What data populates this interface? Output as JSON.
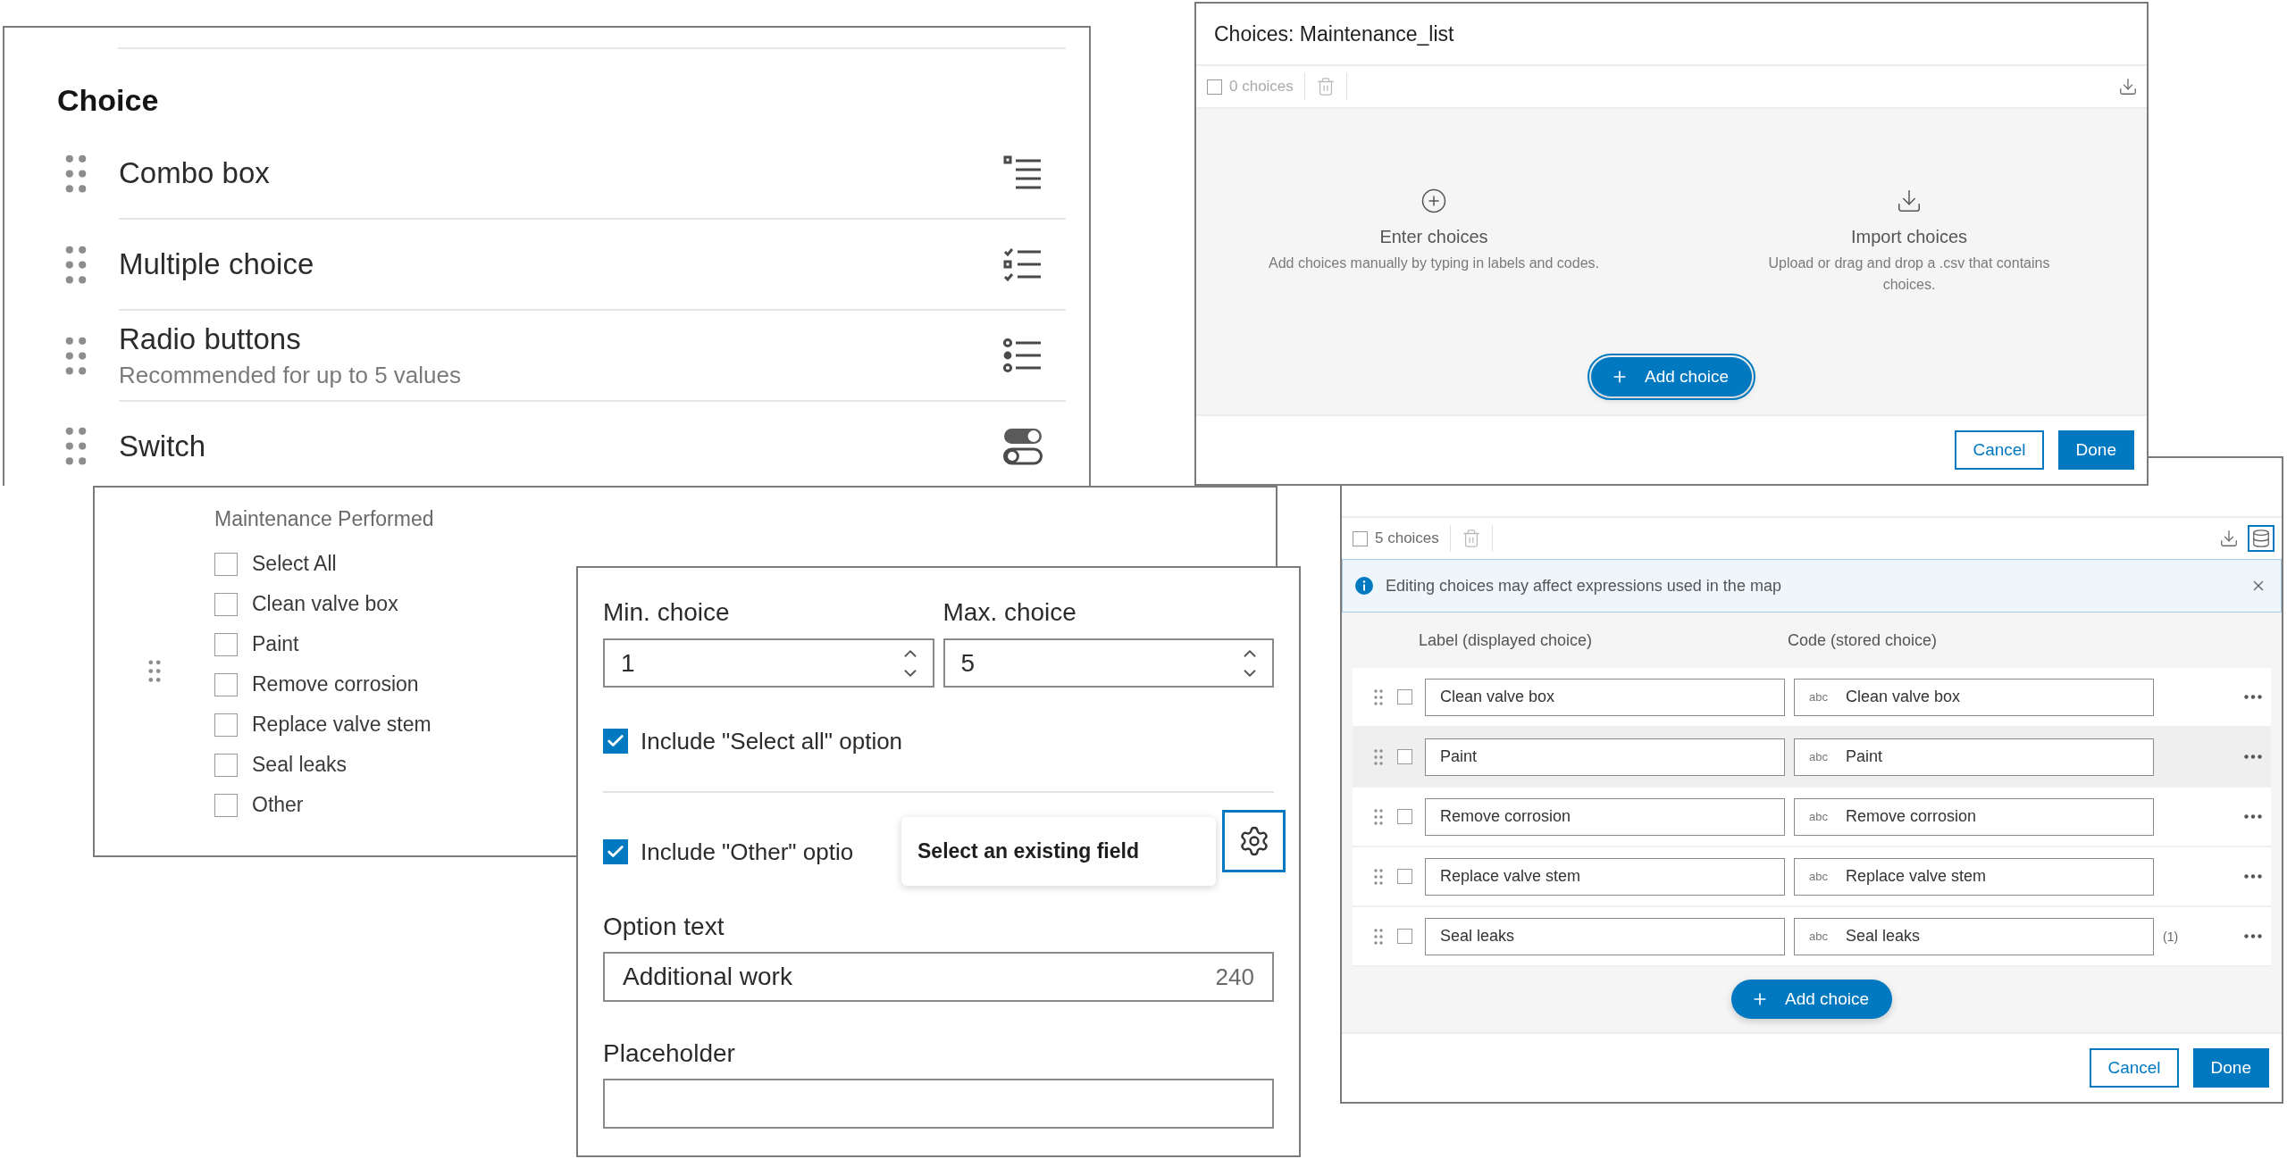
{
  "field_types": {
    "heading": "Choice",
    "items": [
      {
        "kind": "combo",
        "label": "Combo box"
      },
      {
        "kind": "multiple",
        "label": "Multiple choice"
      },
      {
        "kind": "radio",
        "label": "Radio buttons",
        "description": "Recommended for up to 5 values"
      },
      {
        "kind": "switch",
        "label": "Switch"
      }
    ]
  },
  "preview": {
    "title": "Maintenance Performed",
    "options": [
      {
        "label": "Select All",
        "checked": false
      },
      {
        "label": "Clean valve box",
        "checked": false
      },
      {
        "label": "Paint",
        "checked": false
      },
      {
        "label": "Remove corrosion",
        "checked": false
      },
      {
        "label": "Replace valve stem",
        "checked": false
      },
      {
        "label": "Seal leaks",
        "checked": false
      },
      {
        "label": "Other",
        "checked": false
      }
    ]
  },
  "settings": {
    "min": {
      "label": "Min. choice",
      "value": "1"
    },
    "max": {
      "label": "Max. choice",
      "value": "5"
    },
    "select_all": {
      "label": "Include \"Select all\" option",
      "checked": true
    },
    "other": {
      "label": "Include \"Other\" optio",
      "checked": true
    },
    "tooltip": "Select an existing field",
    "option_text": {
      "label": "Option text",
      "value": "Additional work",
      "counter": "240"
    },
    "placeholder": {
      "label": "Placeholder"
    }
  },
  "empty_dialog": {
    "title": "Choices: Maintenance_list",
    "all_checked": false,
    "count": "0 choices",
    "options": [
      {
        "kind": "enter",
        "title": "Enter choices",
        "description": "Add choices manually by typing in labels and codes."
      },
      {
        "kind": "import",
        "title": "Import choices",
        "description": "Upload or drag and drop a .csv that contains choices."
      }
    ],
    "add_button": {
      "label": "Add choice",
      "focused": true
    },
    "cancel": "Cancel",
    "done": "Done"
  },
  "list_dialog": {
    "all_checked": false,
    "count": "5 choices",
    "notice": "Editing choices may affect expressions used in the map",
    "columns": [
      "Label (displayed choice)",
      "Code (stored choice)"
    ],
    "rows": [
      {
        "label": "Clean valve box",
        "type": "abc",
        "code": "Clean valve box",
        "highlighted": false
      },
      {
        "label": "Paint",
        "type": "abc",
        "code": "Paint",
        "highlighted": true
      },
      {
        "label": "Remove corrosion",
        "type": "abc",
        "code": "Remove corrosion",
        "highlighted": false
      },
      {
        "label": "Replace valve stem",
        "type": "abc",
        "code": "Replace valve stem",
        "highlighted": false
      },
      {
        "label": "Seal leaks",
        "type": "abc",
        "code": "Seal leaks",
        "usage": "(1)",
        "highlighted": false
      }
    ],
    "add_button": {
      "label": "Add choice",
      "focused": false
    },
    "cancel": "Cancel",
    "done": "Done"
  }
}
